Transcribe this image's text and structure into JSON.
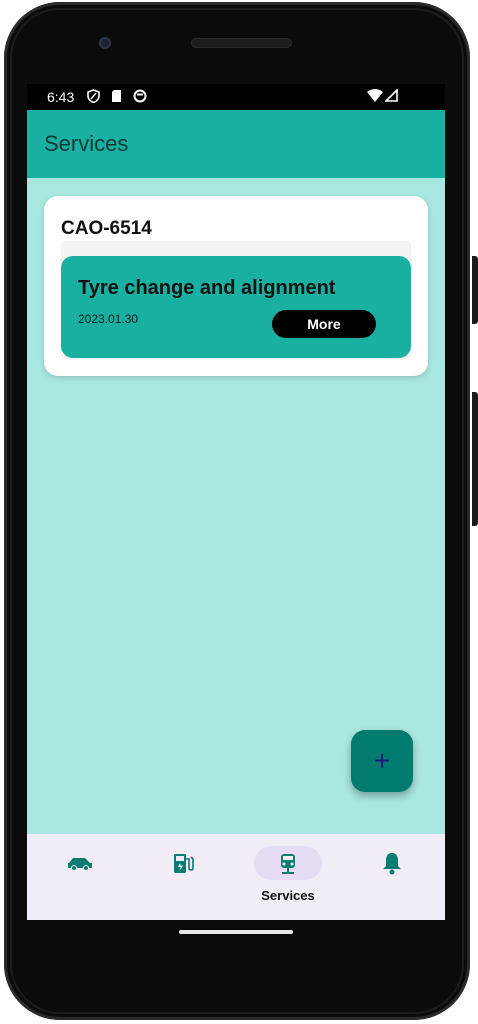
{
  "statusbar": {
    "time": "6:43",
    "icons": [
      "shield-icon",
      "sd-card-icon",
      "data-saver-icon",
      "wifi-icon",
      "signal-icon"
    ]
  },
  "appbar": {
    "title": "Services"
  },
  "vehicle": {
    "plate": "CAO-6514",
    "services": [
      {
        "title": "Tyre change and alignment",
        "date": "2023.01.30",
        "action_label": "More"
      }
    ]
  },
  "fab": {
    "label": "+"
  },
  "bottom_nav": {
    "items": [
      {
        "icon": "car-icon",
        "label": ""
      },
      {
        "icon": "fuel-station-icon",
        "label": ""
      },
      {
        "icon": "services-vehicle-icon",
        "label": "Services",
        "selected": true
      },
      {
        "icon": "bell-icon",
        "label": ""
      }
    ]
  },
  "colors": {
    "primary": "#1ab0a1",
    "background": "#a9e7e1",
    "fab": "#007b6e",
    "nav_background": "#f2ecf7",
    "nav_selected_pill": "#e6ddf4",
    "icon": "#0a7c70"
  }
}
